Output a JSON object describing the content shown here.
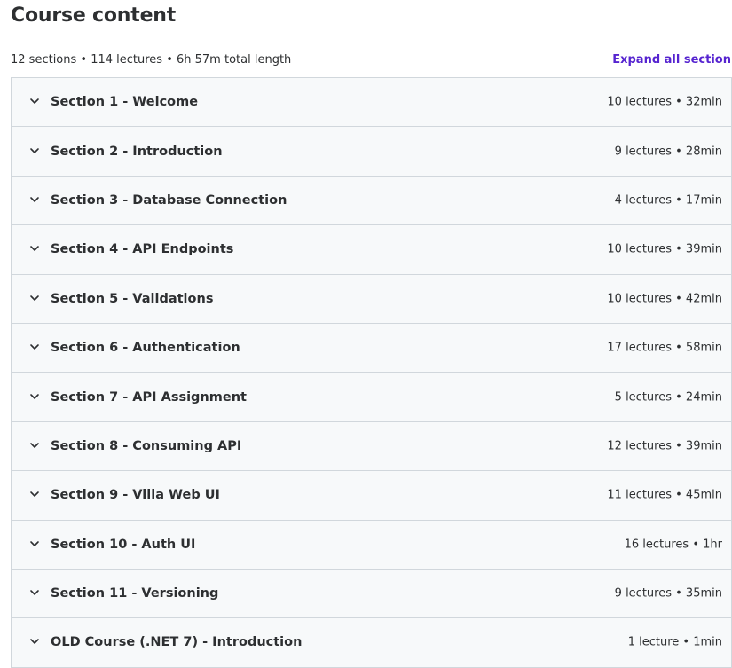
{
  "header": {
    "title": "Course content",
    "summary": "12 sections • 114 lectures • 6h 57m total length",
    "expand_all_label": "Expand all section"
  },
  "colors": {
    "accent": "#5624d0",
    "row_background": "#f7f9fa",
    "border": "#d1d7dc",
    "text": "#2d2f31"
  },
  "icons": {
    "section_toggle": "chevron-down-icon"
  },
  "sections": [
    {
      "title": "Section 1 - Welcome",
      "meta": "10 lectures • 32min"
    },
    {
      "title": "Section 2 - Introduction",
      "meta": "9 lectures • 28min"
    },
    {
      "title": "Section 3 - Database Connection",
      "meta": "4 lectures • 17min"
    },
    {
      "title": "Section 4 - API Endpoints",
      "meta": "10 lectures • 39min"
    },
    {
      "title": "Section 5 - Validations",
      "meta": "10 lectures • 42min"
    },
    {
      "title": "Section 6 - Authentication",
      "meta": "17 lectures • 58min"
    },
    {
      "title": "Section 7 - API Assignment",
      "meta": "5 lectures • 24min"
    },
    {
      "title": "Section 8 - Consuming API",
      "meta": "12 lectures • 39min"
    },
    {
      "title": "Section 9 - Villa Web UI",
      "meta": "11 lectures • 45min"
    },
    {
      "title": "Section 10 - Auth UI",
      "meta": "16 lectures • 1hr"
    },
    {
      "title": "Section 11 - Versioning",
      "meta": "9 lectures • 35min"
    },
    {
      "title": "OLD Course (.NET 7) - Introduction",
      "meta": "1 lecture • 1min"
    }
  ]
}
